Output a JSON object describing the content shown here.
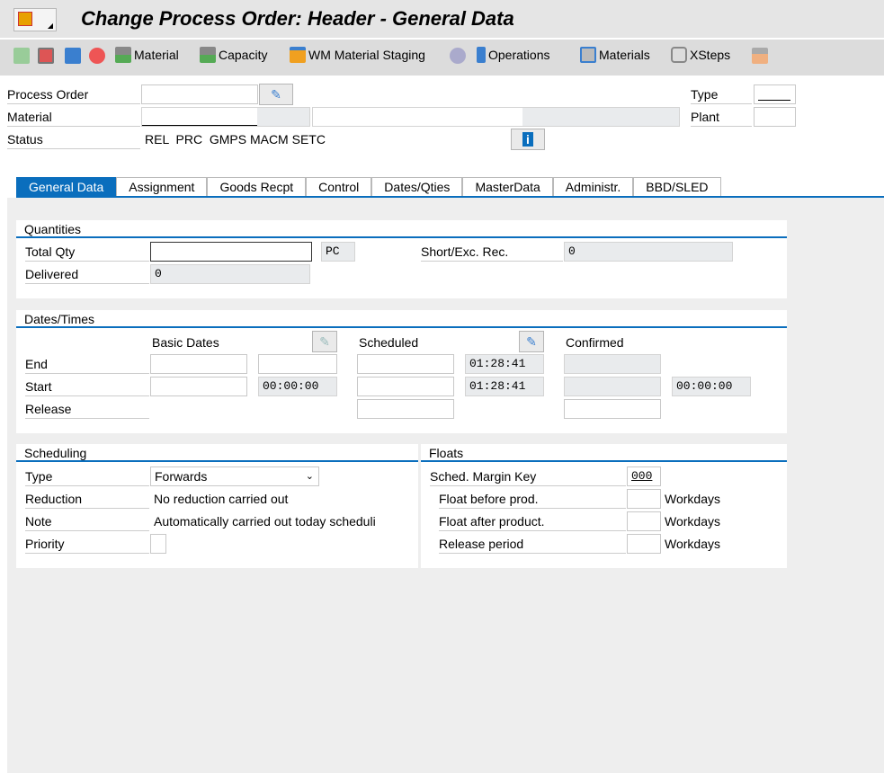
{
  "title": "Change Process Order: Header - General Data",
  "toolbar": {
    "material": "Material",
    "capacity": "Capacity",
    "wm_staging": "WM Material Staging",
    "operations": "Operations",
    "materials": "Materials",
    "xsteps": "XSteps"
  },
  "header": {
    "process_order_label": "Process Order",
    "process_order_value": "",
    "material_label": "Material",
    "status_label": "Status",
    "status_value": "REL  PRC  GMPS MACM SETC",
    "type_label": "Type",
    "plant_label": "Plant"
  },
  "tabs": [
    "General Data",
    "Assignment",
    "Goods Recpt",
    "Control",
    "Dates/Qties",
    "MasterData",
    "Administr.",
    "BBD/SLED"
  ],
  "quantities": {
    "title": "Quantities",
    "total_qty_label": "Total Qty",
    "total_qty": "",
    "unit": "PC",
    "delivered_label": "Delivered",
    "delivered": "0",
    "short_label": "Short/Exc. Rec.",
    "short": "0"
  },
  "dates": {
    "title": "Dates/Times",
    "basic": "Basic Dates",
    "scheduled": "Scheduled",
    "confirmed": "Confirmed",
    "end_label": "End",
    "start_label": "Start",
    "release_label": "Release",
    "sched_end_time": "01:28:41",
    "sched_start_time": "01:28:41",
    "basic_start_time": "00:00:00",
    "conf_start_time": "00:00:00"
  },
  "scheduling": {
    "title": "Scheduling",
    "type_label": "Type",
    "type_value": "Forwards",
    "reduction_label": "Reduction",
    "reduction_value": "No reduction carried out",
    "note_label": "Note",
    "note_value": "Automatically carried out today scheduli",
    "priority_label": "Priority"
  },
  "floats": {
    "title": "Floats",
    "margin_key_label": "Sched. Margin Key",
    "margin_key": "000",
    "before_label": "Float before prod.",
    "after_label": "Float after product.",
    "release_label": "Release period",
    "unit": "Workdays"
  }
}
